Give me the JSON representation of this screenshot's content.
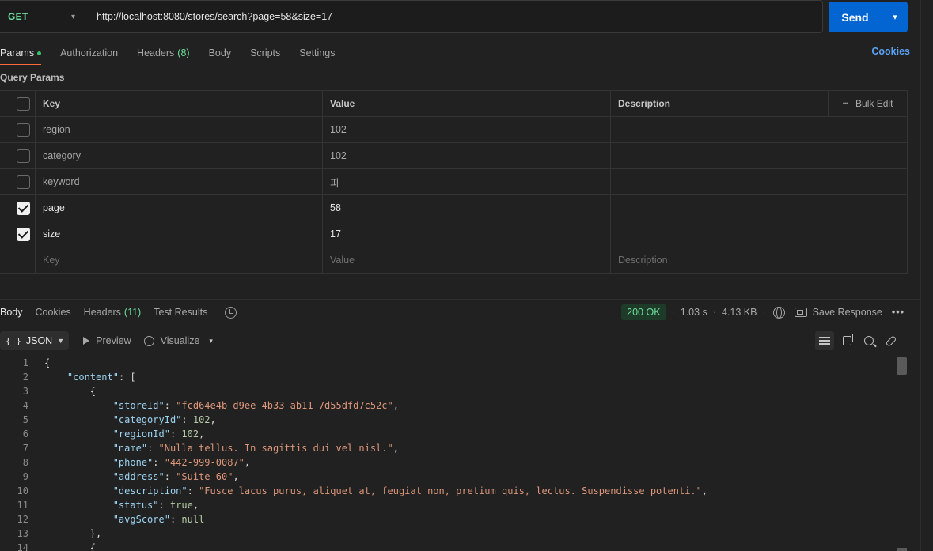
{
  "request": {
    "method": "GET",
    "url": "http://localhost:8080/stores/search?page=58&size=17",
    "send_label": "Send"
  },
  "tabs": {
    "params": "Params",
    "authorization": "Authorization",
    "headers": "Headers",
    "headers_count": "(8)",
    "body": "Body",
    "scripts": "Scripts",
    "settings": "Settings",
    "cookies": "Cookies"
  },
  "query_params": {
    "title": "Query Params",
    "columns": {
      "key": "Key",
      "value": "Value",
      "description": "Description",
      "bulk_edit": "Bulk Edit"
    },
    "rows": [
      {
        "key": "region",
        "value": "102",
        "checked": false
      },
      {
        "key": "category",
        "value": "102",
        "checked": false
      },
      {
        "key": "keyword",
        "value": "피",
        "checked": false
      },
      {
        "key": "page",
        "value": "58",
        "checked": true
      },
      {
        "key": "size",
        "value": "17",
        "checked": true
      }
    ],
    "placeholder": {
      "key": "Key",
      "value": "Value",
      "description": "Description"
    }
  },
  "response": {
    "tabs": {
      "body": "Body",
      "cookies": "Cookies",
      "headers": "Headers",
      "headers_count": "(11)",
      "test_results": "Test Results"
    },
    "status": "200 OK",
    "time": "1.03 s",
    "size": "4.13 KB",
    "save_response": "Save Response",
    "more": "•••",
    "format": "JSON",
    "preview": "Preview",
    "visualize": "Visualize"
  },
  "code_lines": [
    {
      "n": "1",
      "html": "{"
    },
    {
      "n": "2",
      "html": "    <span class=\"k\">\"content\"</span>: ["
    },
    {
      "n": "3",
      "html": "        {"
    },
    {
      "n": "4",
      "html": "            <span class=\"k\">\"storeId\"</span>: <span class=\"s\">\"fcd64e4b-d9ee-4b33-ab11-7d55dfd7c52c\"</span>,"
    },
    {
      "n": "5",
      "html": "            <span class=\"k\">\"categoryId\"</span>: <span class=\"n\">102</span>,"
    },
    {
      "n": "6",
      "html": "            <span class=\"k\">\"regionId\"</span>: <span class=\"n\">102</span>,"
    },
    {
      "n": "7",
      "html": "            <span class=\"k\">\"name\"</span>: <span class=\"s\">\"Nulla tellus. In sagittis dui vel nisl.\"</span>,"
    },
    {
      "n": "8",
      "html": "            <span class=\"k\">\"phone\"</span>: <span class=\"s\">\"442-999-0087\"</span>,"
    },
    {
      "n": "9",
      "html": "            <span class=\"k\">\"address\"</span>: <span class=\"s\">\"Suite 60\"</span>,"
    },
    {
      "n": "10",
      "html": "            <span class=\"k\">\"description\"</span>: <span class=\"s\">\"Fusce lacus purus, aliquet at, feugiat non, pretium quis, lectus. Suspendisse potenti.\"</span>,"
    },
    {
      "n": "11",
      "html": "            <span class=\"k\">\"status\"</span>: <span class=\"n\">true</span>,"
    },
    {
      "n": "12",
      "html": "            <span class=\"k\">\"avgScore\"</span>: <span class=\"n\">null</span>"
    },
    {
      "n": "13",
      "html": "        },"
    },
    {
      "n": "14",
      "html": "        {"
    }
  ]
}
